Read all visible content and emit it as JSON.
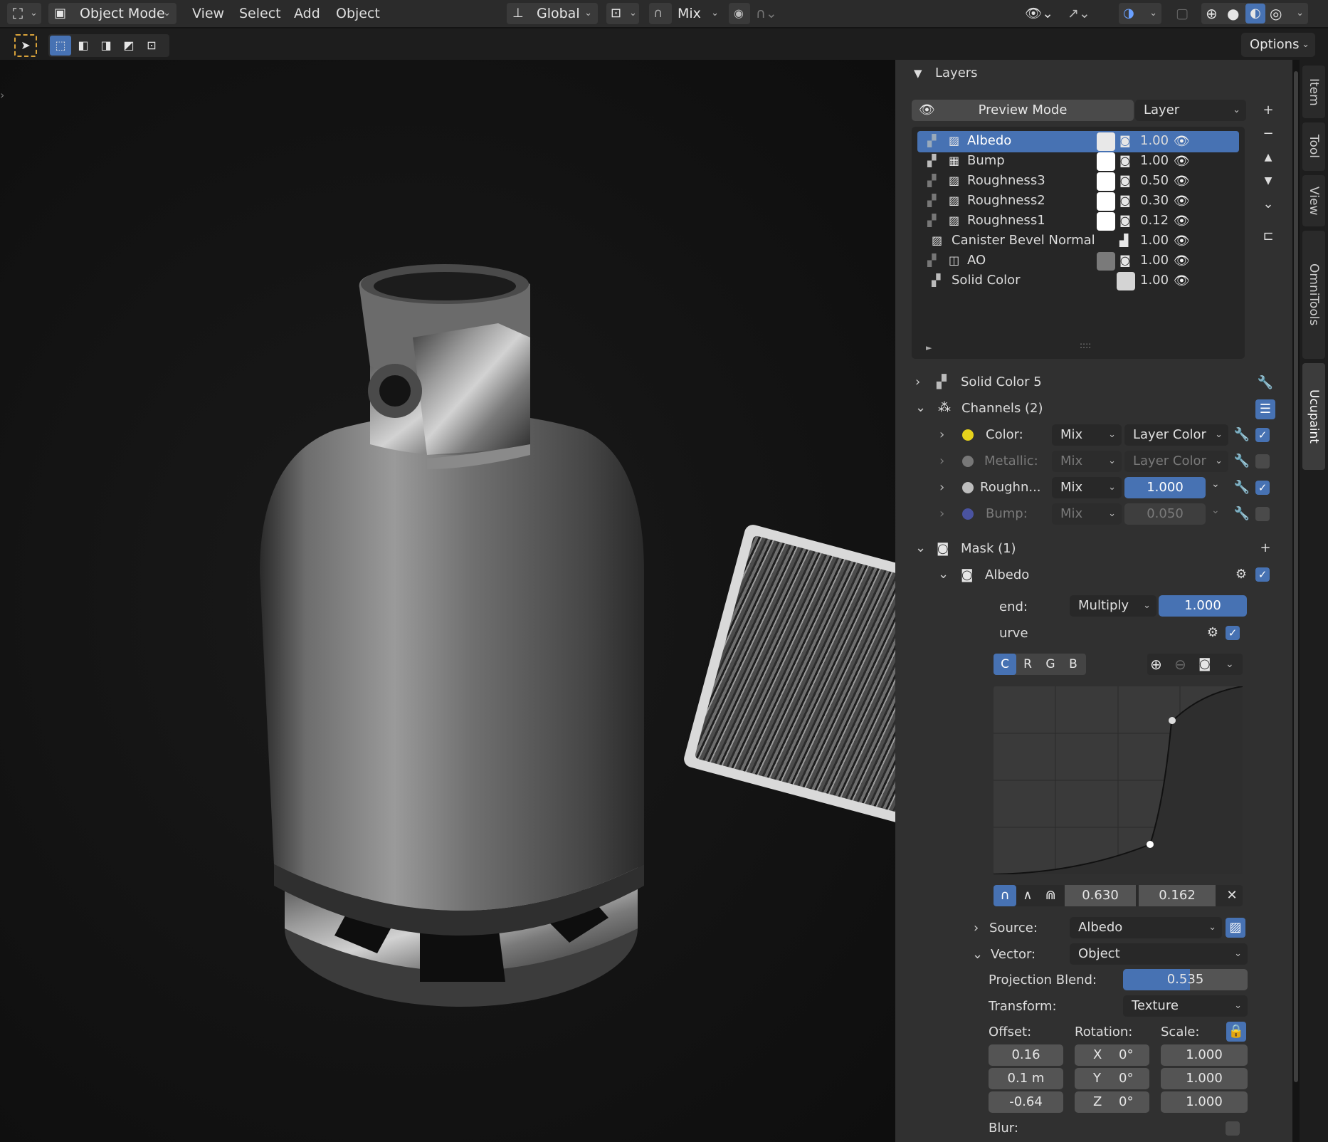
{
  "topbar": {
    "mode": "Object Mode",
    "menu": [
      "View",
      "Select",
      "Add",
      "Object"
    ],
    "transform": "Global",
    "snap_mode": "Mix"
  },
  "toolbar": {
    "options": "Options"
  },
  "tabs": [
    "Item",
    "Tool",
    "View",
    "OmniTools",
    "Ucupaint"
  ],
  "layers_panel": {
    "title": "Layers",
    "preview_mode": "Preview Mode",
    "layer_select": "Layer",
    "items": [
      {
        "name": "Albedo",
        "value": "1.00",
        "swatch": "#e8e8e8"
      },
      {
        "name": "Bump",
        "value": "1.00",
        "swatch": "#ffffff"
      },
      {
        "name": "Roughness3",
        "value": "0.50",
        "swatch": "#ffffff"
      },
      {
        "name": "Roughness2",
        "value": "0.30",
        "swatch": "#ffffff"
      },
      {
        "name": "Roughness1",
        "value": "0.12",
        "swatch": "#ffffff"
      },
      {
        "name": "Canister Bevel Normal",
        "value": "1.00",
        "swatch": ""
      },
      {
        "name": "AO",
        "value": "1.00",
        "swatch": "#7a7a7a"
      },
      {
        "name": "Solid Color",
        "value": "1.00",
        "swatch": "#d4d4d4"
      }
    ],
    "list_handle": "::::"
  },
  "solid_color": "Solid Color 5",
  "channels": {
    "title": "Channels (2)",
    "items": [
      {
        "name": "Color:",
        "blend": "Mix",
        "value": "Layer Color",
        "dot": "#e6d21c",
        "enabled": true
      },
      {
        "name": "Metallic:",
        "blend": "Mix",
        "value": "Layer Color",
        "dot": "#777777",
        "enabled": false
      },
      {
        "name": "Roughn...",
        "blend": "Mix",
        "value": "1.000",
        "dot": "#bdbdbd",
        "enabled": true
      },
      {
        "name": "Bump:",
        "blend": "Mix",
        "value": "0.050",
        "dot": "#4a53a0",
        "enabled": false
      }
    ]
  },
  "mask": {
    "title": "Mask (1)",
    "item": "Albedo",
    "blend_label": "end:",
    "blend": "Multiply",
    "blend_value": "1.000",
    "curve_label": "urve",
    "curve_channels": [
      "C",
      "R",
      "G",
      "B"
    ],
    "curve_point_x": "0.630",
    "curve_point_y": "0.162",
    "source_label": "Source:",
    "source": "Albedo",
    "vector_label": "Vector:",
    "vector": "Object",
    "projection_blend_label": "Projection Blend:",
    "projection_blend": "0.535",
    "transform_label": "Transform:",
    "transform": "Texture",
    "offset_label": "Offset:",
    "rotation_label": "Rotation:",
    "scale_label": "Scale:",
    "offset": [
      "0.16",
      "0.1 m",
      "-0.64"
    ],
    "rotation_axes": [
      "X",
      "Y",
      "Z"
    ],
    "rotation": [
      "0°",
      "0°",
      "0°"
    ],
    "scale": [
      "1.000",
      "1.000",
      "1.000"
    ],
    "blur_label": "Blur:"
  }
}
